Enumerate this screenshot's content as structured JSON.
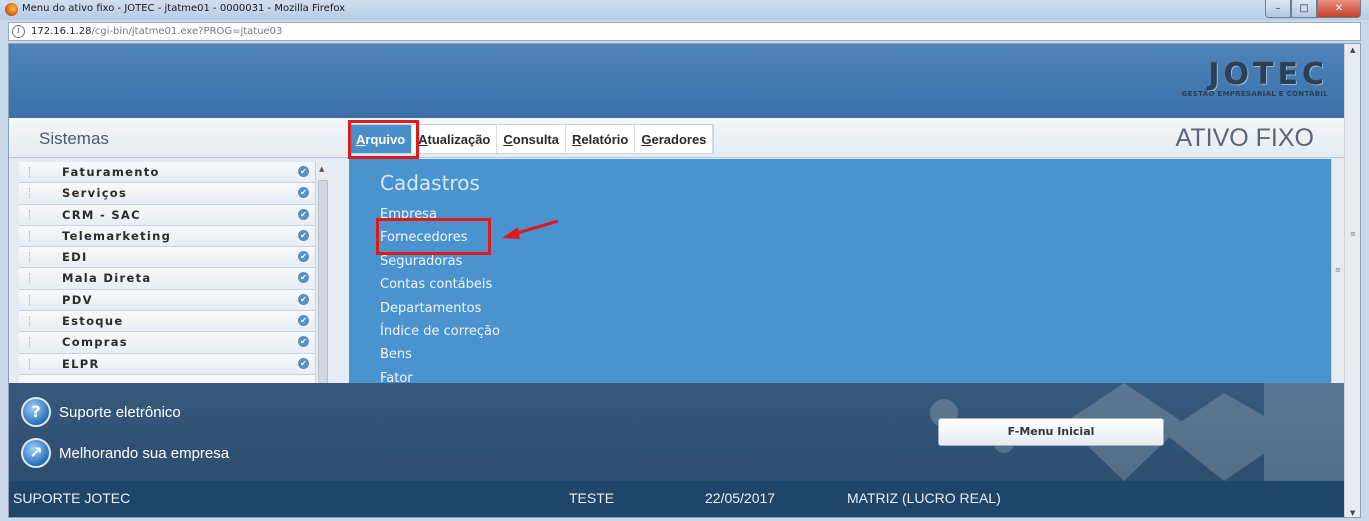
{
  "browser": {
    "window_title": "Menu do ativo fixo - JOTEC - jtatme01 - 0000031 - Mozilla Firefox",
    "url_host": "172.16.1.28",
    "url_path": "/cgi-bin/jtatme01.exe?PROG=jtatue03",
    "buttons": {
      "minimize": "–",
      "maximize": "□",
      "close": "✕"
    }
  },
  "header": {
    "logo_text": "JOTEC",
    "logo_tagline": "GESTÃO EMPRESARIAL E CONTÁBIL",
    "sistemas_label": "Sistemas",
    "module_title": "ATIVO FIXO"
  },
  "menu": {
    "items": [
      {
        "hotkey": "A",
        "rest": "rquivo"
      },
      {
        "hotkey": "A",
        "rest": "tualização"
      },
      {
        "hotkey": "C",
        "rest": "onsulta"
      },
      {
        "hotkey": "R",
        "rest": "elatório"
      },
      {
        "hotkey": "G",
        "rest": "eradores"
      }
    ]
  },
  "sidebar": {
    "items": [
      {
        "label": "Faturamento"
      },
      {
        "label": "Serviços"
      },
      {
        "label": "CRM - SAC"
      },
      {
        "label": "Telemarketing"
      },
      {
        "label": "EDI"
      },
      {
        "label": "Mala Direta"
      },
      {
        "label": "PDV"
      },
      {
        "label": "Estoque"
      },
      {
        "label": "Compras"
      },
      {
        "label": "ELPR"
      }
    ],
    "check_glyph": "✔"
  },
  "panel": {
    "title": "Cadastros",
    "items": [
      "Empresa",
      "Fornecedores",
      "Seguradoras",
      "Contas contábeis",
      "Departamentos",
      "Índice de correção",
      "Bens",
      "Fator"
    ]
  },
  "support": {
    "item1": "Suporte eletrônico",
    "item2": "Melhorando sua empresa",
    "item1_icon": "?",
    "fmenu_button": "F-Menu Inicial"
  },
  "status": {
    "support": "SUPORTE JOTEC",
    "user": "TESTE",
    "date": "22/05/2017",
    "company": "MATRIZ (LUCRO REAL)"
  },
  "colors": {
    "highlight": "#e01a1a",
    "panel_blue": "#4b93cf",
    "status_bar": "#1f4668"
  }
}
